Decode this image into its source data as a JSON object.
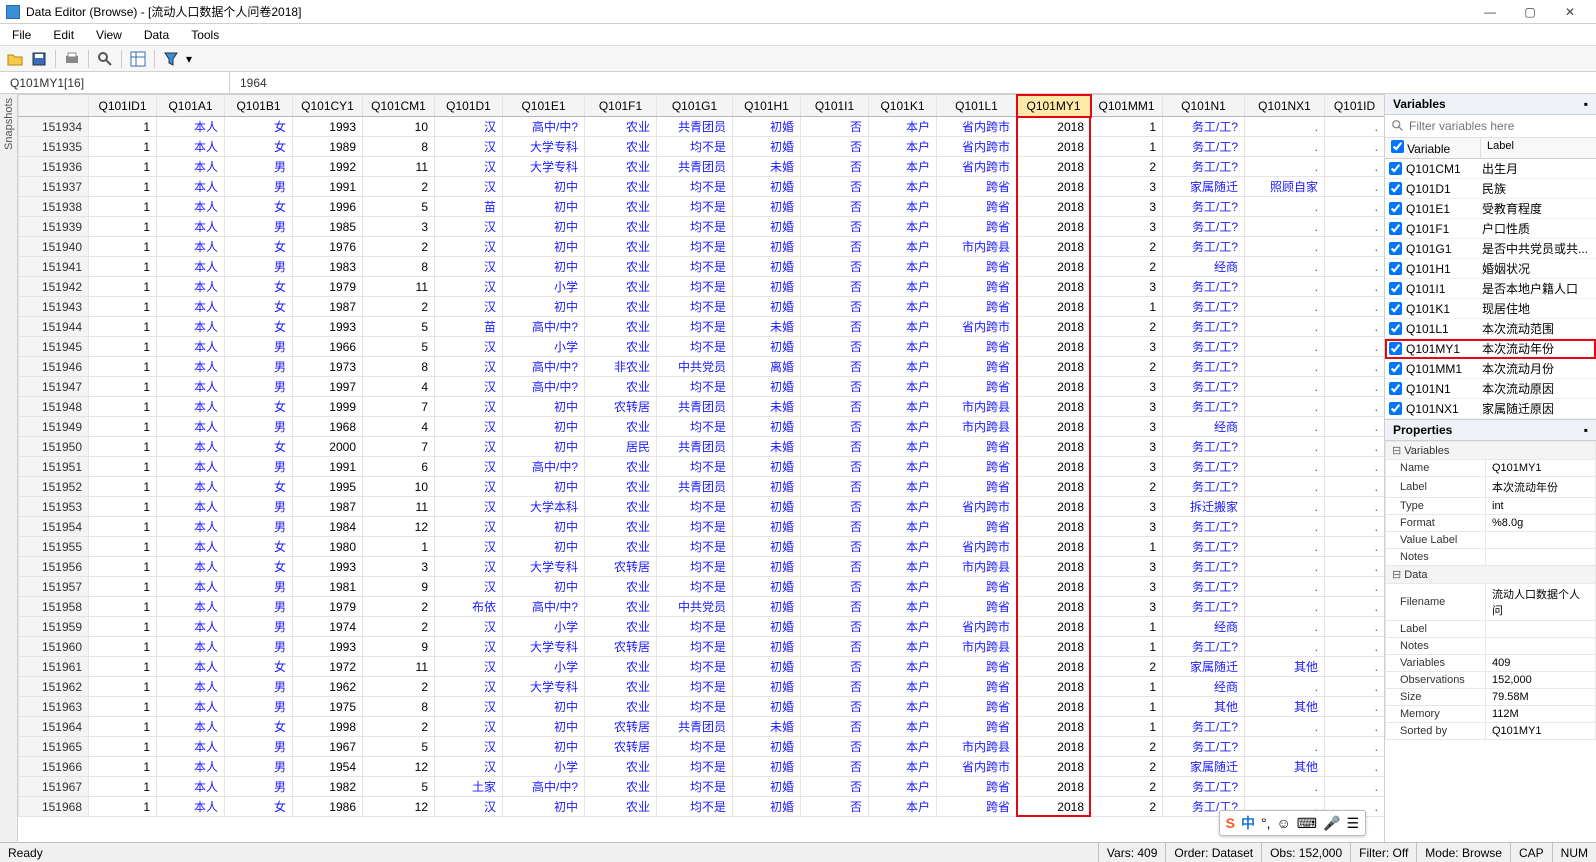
{
  "title": "Data Editor (Browse) - [流动人口数据个人问卷2018]",
  "menu": [
    "File",
    "Edit",
    "View",
    "Data",
    "Tools"
  ],
  "snapshots_tab": "Snapshots",
  "cellref": "Q101MY1[16]",
  "cellval": "1964",
  "columns": [
    "",
    "Q101ID1",
    "Q101A1",
    "Q101B1",
    "Q101CY1",
    "Q101CM1",
    "Q101D1",
    "Q101E1",
    "Q101F1",
    "Q101G1",
    "Q101H1",
    "Q101I1",
    "Q101K1",
    "Q101L1",
    "Q101MY1",
    "Q101MM1",
    "Q101N1",
    "Q101NX1",
    "Q101ID"
  ],
  "hl_col_index": 14,
  "rows": [
    [
      "151934",
      "1",
      "本人",
      "女",
      "1993",
      "10",
      "汉",
      "高中/中?",
      "农业",
      "共青团员",
      "初婚",
      "否",
      "本户",
      "省内跨市",
      "2018",
      "1",
      "务工/工?",
      ".",
      "."
    ],
    [
      "151935",
      "1",
      "本人",
      "女",
      "1989",
      "8",
      "汉",
      "大学专科",
      "农业",
      "均不是",
      "初婚",
      "否",
      "本户",
      "省内跨市",
      "2018",
      "1",
      "务工/工?",
      ".",
      "."
    ],
    [
      "151936",
      "1",
      "本人",
      "男",
      "1992",
      "11",
      "汉",
      "大学专科",
      "农业",
      "共青团员",
      "未婚",
      "否",
      "本户",
      "省内跨市",
      "2018",
      "2",
      "务工/工?",
      ".",
      "."
    ],
    [
      "151937",
      "1",
      "本人",
      "男",
      "1991",
      "2",
      "汉",
      "初中",
      "农业",
      "均不是",
      "初婚",
      "否",
      "本户",
      "跨省",
      "2018",
      "3",
      "家属随迁",
      "照顾自家",
      "."
    ],
    [
      "151938",
      "1",
      "本人",
      "女",
      "1996",
      "5",
      "苗",
      "初中",
      "农业",
      "均不是",
      "初婚",
      "否",
      "本户",
      "跨省",
      "2018",
      "3",
      "务工/工?",
      ".",
      "."
    ],
    [
      "151939",
      "1",
      "本人",
      "男",
      "1985",
      "3",
      "汉",
      "初中",
      "农业",
      "均不是",
      "初婚",
      "否",
      "本户",
      "跨省",
      "2018",
      "3",
      "务工/工?",
      ".",
      "."
    ],
    [
      "151940",
      "1",
      "本人",
      "女",
      "1976",
      "2",
      "汉",
      "初中",
      "农业",
      "均不是",
      "初婚",
      "否",
      "本户",
      "市内跨县",
      "2018",
      "2",
      "务工/工?",
      ".",
      "."
    ],
    [
      "151941",
      "1",
      "本人",
      "男",
      "1983",
      "8",
      "汉",
      "初中",
      "农业",
      "均不是",
      "初婚",
      "否",
      "本户",
      "跨省",
      "2018",
      "2",
      "经商",
      ".",
      "."
    ],
    [
      "151942",
      "1",
      "本人",
      "女",
      "1979",
      "11",
      "汉",
      "小学",
      "农业",
      "均不是",
      "初婚",
      "否",
      "本户",
      "跨省",
      "2018",
      "3",
      "务工/工?",
      ".",
      "."
    ],
    [
      "151943",
      "1",
      "本人",
      "女",
      "1987",
      "2",
      "汉",
      "初中",
      "农业",
      "均不是",
      "初婚",
      "否",
      "本户",
      "跨省",
      "2018",
      "1",
      "务工/工?",
      ".",
      "."
    ],
    [
      "151944",
      "1",
      "本人",
      "女",
      "1993",
      "5",
      "苗",
      "高中/中?",
      "农业",
      "均不是",
      "未婚",
      "否",
      "本户",
      "省内跨市",
      "2018",
      "2",
      "务工/工?",
      ".",
      "."
    ],
    [
      "151945",
      "1",
      "本人",
      "男",
      "1966",
      "5",
      "汉",
      "小学",
      "农业",
      "均不是",
      "初婚",
      "否",
      "本户",
      "跨省",
      "2018",
      "3",
      "务工/工?",
      ".",
      "."
    ],
    [
      "151946",
      "1",
      "本人",
      "男",
      "1973",
      "8",
      "汉",
      "高中/中?",
      "非农业",
      "中共党员",
      "离婚",
      "否",
      "本户",
      "跨省",
      "2018",
      "2",
      "务工/工?",
      ".",
      "."
    ],
    [
      "151947",
      "1",
      "本人",
      "男",
      "1997",
      "4",
      "汉",
      "高中/中?",
      "农业",
      "均不是",
      "初婚",
      "否",
      "本户",
      "跨省",
      "2018",
      "3",
      "务工/工?",
      ".",
      "."
    ],
    [
      "151948",
      "1",
      "本人",
      "女",
      "1999",
      "7",
      "汉",
      "初中",
      "农转居",
      "共青团员",
      "未婚",
      "否",
      "本户",
      "市内跨县",
      "2018",
      "3",
      "务工/工?",
      ".",
      "."
    ],
    [
      "151949",
      "1",
      "本人",
      "男",
      "1968",
      "4",
      "汉",
      "初中",
      "农业",
      "均不是",
      "初婚",
      "否",
      "本户",
      "市内跨县",
      "2018",
      "3",
      "经商",
      ".",
      "."
    ],
    [
      "151950",
      "1",
      "本人",
      "女",
      "2000",
      "7",
      "汉",
      "初中",
      "居民",
      "共青团员",
      "未婚",
      "否",
      "本户",
      "跨省",
      "2018",
      "3",
      "务工/工?",
      ".",
      "."
    ],
    [
      "151951",
      "1",
      "本人",
      "男",
      "1991",
      "6",
      "汉",
      "高中/中?",
      "农业",
      "均不是",
      "初婚",
      "否",
      "本户",
      "跨省",
      "2018",
      "3",
      "务工/工?",
      ".",
      "."
    ],
    [
      "151952",
      "1",
      "本人",
      "女",
      "1995",
      "10",
      "汉",
      "初中",
      "农业",
      "共青团员",
      "初婚",
      "否",
      "本户",
      "跨省",
      "2018",
      "2",
      "务工/工?",
      ".",
      "."
    ],
    [
      "151953",
      "1",
      "本人",
      "男",
      "1987",
      "11",
      "汉",
      "大学本科",
      "农业",
      "均不是",
      "初婚",
      "否",
      "本户",
      "省内跨市",
      "2018",
      "3",
      "拆迁搬家",
      ".",
      "."
    ],
    [
      "151954",
      "1",
      "本人",
      "男",
      "1984",
      "12",
      "汉",
      "初中",
      "农业",
      "均不是",
      "初婚",
      "否",
      "本户",
      "跨省",
      "2018",
      "3",
      "务工/工?",
      ".",
      "."
    ],
    [
      "151955",
      "1",
      "本人",
      "女",
      "1980",
      "1",
      "汉",
      "初中",
      "农业",
      "均不是",
      "初婚",
      "否",
      "本户",
      "省内跨市",
      "2018",
      "1",
      "务工/工?",
      ".",
      "."
    ],
    [
      "151956",
      "1",
      "本人",
      "女",
      "1993",
      "3",
      "汉",
      "大学专科",
      "农转居",
      "均不是",
      "初婚",
      "否",
      "本户",
      "市内跨县",
      "2018",
      "3",
      "务工/工?",
      ".",
      "."
    ],
    [
      "151957",
      "1",
      "本人",
      "男",
      "1981",
      "9",
      "汉",
      "初中",
      "农业",
      "均不是",
      "初婚",
      "否",
      "本户",
      "跨省",
      "2018",
      "3",
      "务工/工?",
      ".",
      "."
    ],
    [
      "151958",
      "1",
      "本人",
      "男",
      "1979",
      "2",
      "布依",
      "高中/中?",
      "农业",
      "中共党员",
      "初婚",
      "否",
      "本户",
      "跨省",
      "2018",
      "3",
      "务工/工?",
      ".",
      "."
    ],
    [
      "151959",
      "1",
      "本人",
      "男",
      "1974",
      "2",
      "汉",
      "小学",
      "农业",
      "均不是",
      "初婚",
      "否",
      "本户",
      "省内跨市",
      "2018",
      "1",
      "经商",
      ".",
      "."
    ],
    [
      "151960",
      "1",
      "本人",
      "男",
      "1993",
      "9",
      "汉",
      "大学专科",
      "农转居",
      "均不是",
      "初婚",
      "否",
      "本户",
      "市内跨县",
      "2018",
      "1",
      "务工/工?",
      ".",
      "."
    ],
    [
      "151961",
      "1",
      "本人",
      "女",
      "1972",
      "11",
      "汉",
      "小学",
      "农业",
      "均不是",
      "初婚",
      "否",
      "本户",
      "跨省",
      "2018",
      "2",
      "家属随迁",
      "其他",
      "."
    ],
    [
      "151962",
      "1",
      "本人",
      "男",
      "1962",
      "2",
      "汉",
      "大学专科",
      "农业",
      "均不是",
      "初婚",
      "否",
      "本户",
      "跨省",
      "2018",
      "1",
      "经商",
      ".",
      "."
    ],
    [
      "151963",
      "1",
      "本人",
      "男",
      "1975",
      "8",
      "汉",
      "初中",
      "农业",
      "均不是",
      "初婚",
      "否",
      "本户",
      "跨省",
      "2018",
      "1",
      "其他",
      "其他",
      "."
    ],
    [
      "151964",
      "1",
      "本人",
      "女",
      "1998",
      "2",
      "汉",
      "初中",
      "农转居",
      "共青团员",
      "未婚",
      "否",
      "本户",
      "跨省",
      "2018",
      "1",
      "务工/工?",
      ".",
      "."
    ],
    [
      "151965",
      "1",
      "本人",
      "男",
      "1967",
      "5",
      "汉",
      "初中",
      "农转居",
      "均不是",
      "初婚",
      "否",
      "本户",
      "市内跨县",
      "2018",
      "2",
      "务工/工?",
      ".",
      "."
    ],
    [
      "151966",
      "1",
      "本人",
      "男",
      "1954",
      "12",
      "汉",
      "小学",
      "农业",
      "均不是",
      "初婚",
      "否",
      "本户",
      "省内跨市",
      "2018",
      "2",
      "家属随迁",
      "其他",
      "."
    ],
    [
      "151967",
      "1",
      "本人",
      "男",
      "1982",
      "5",
      "土家",
      "高中/中?",
      "农业",
      "均不是",
      "初婚",
      "否",
      "本户",
      "跨省",
      "2018",
      "2",
      "务工/工?",
      ".",
      "."
    ],
    [
      "151968",
      "1",
      "本人",
      "女",
      "1986",
      "12",
      "汉",
      "初中",
      "农业",
      "均不是",
      "初婚",
      "否",
      "本户",
      "跨省",
      "2018",
      "2",
      "务工/工?",
      ".",
      "."
    ]
  ],
  "variables_header": "Variables",
  "filter_placeholder": "Filter variables here",
  "varcols": {
    "c1": "Variable",
    "c2": "Label"
  },
  "variables": [
    {
      "name": "Q101CM1",
      "label": "出生月"
    },
    {
      "name": "Q101D1",
      "label": "民族"
    },
    {
      "name": "Q101E1",
      "label": "受教育程度"
    },
    {
      "name": "Q101F1",
      "label": "户口性质"
    },
    {
      "name": "Q101G1",
      "label": "是否中共党员或共..."
    },
    {
      "name": "Q101H1",
      "label": "婚姻状况"
    },
    {
      "name": "Q101I1",
      "label": "是否本地户籍人口"
    },
    {
      "name": "Q101K1",
      "label": "现居住地"
    },
    {
      "name": "Q101L1",
      "label": "本次流动范围"
    },
    {
      "name": "Q101MY1",
      "label": "本次流动年份",
      "hl": true
    },
    {
      "name": "Q101MM1",
      "label": "本次流动月份"
    },
    {
      "name": "Q101N1",
      "label": "本次流动原因"
    },
    {
      "name": "Q101NX1",
      "label": "家属随迁原因"
    }
  ],
  "properties_header": "Properties",
  "props_var_section": "Variables",
  "props_var": [
    [
      "Name",
      "Q101MY1"
    ],
    [
      "Label",
      "本次流动年份"
    ],
    [
      "Type",
      "int"
    ],
    [
      "Format",
      "%8.0g"
    ],
    [
      "Value Label",
      ""
    ],
    [
      "Notes",
      ""
    ]
  ],
  "props_data_section": "Data",
  "props_data": [
    [
      "Filename",
      "流动人口数据个人问"
    ],
    [
      "Label",
      ""
    ],
    [
      "Notes",
      ""
    ],
    [
      "Variables",
      "409"
    ],
    [
      "Observations",
      "152,000"
    ],
    [
      "Size",
      "79.58M"
    ],
    [
      "Memory",
      "112M"
    ],
    [
      "Sorted by",
      "Q101MY1"
    ]
  ],
  "status": {
    "ready": "Ready",
    "vars": "Vars: 409",
    "order": "Order: Dataset",
    "obs": "Obs: 152,000",
    "filter": "Filter: Off",
    "mode": "Mode: Browse",
    "cap": "CAP",
    "num": "NUM"
  },
  "floatbar": {
    "ime": "中"
  }
}
